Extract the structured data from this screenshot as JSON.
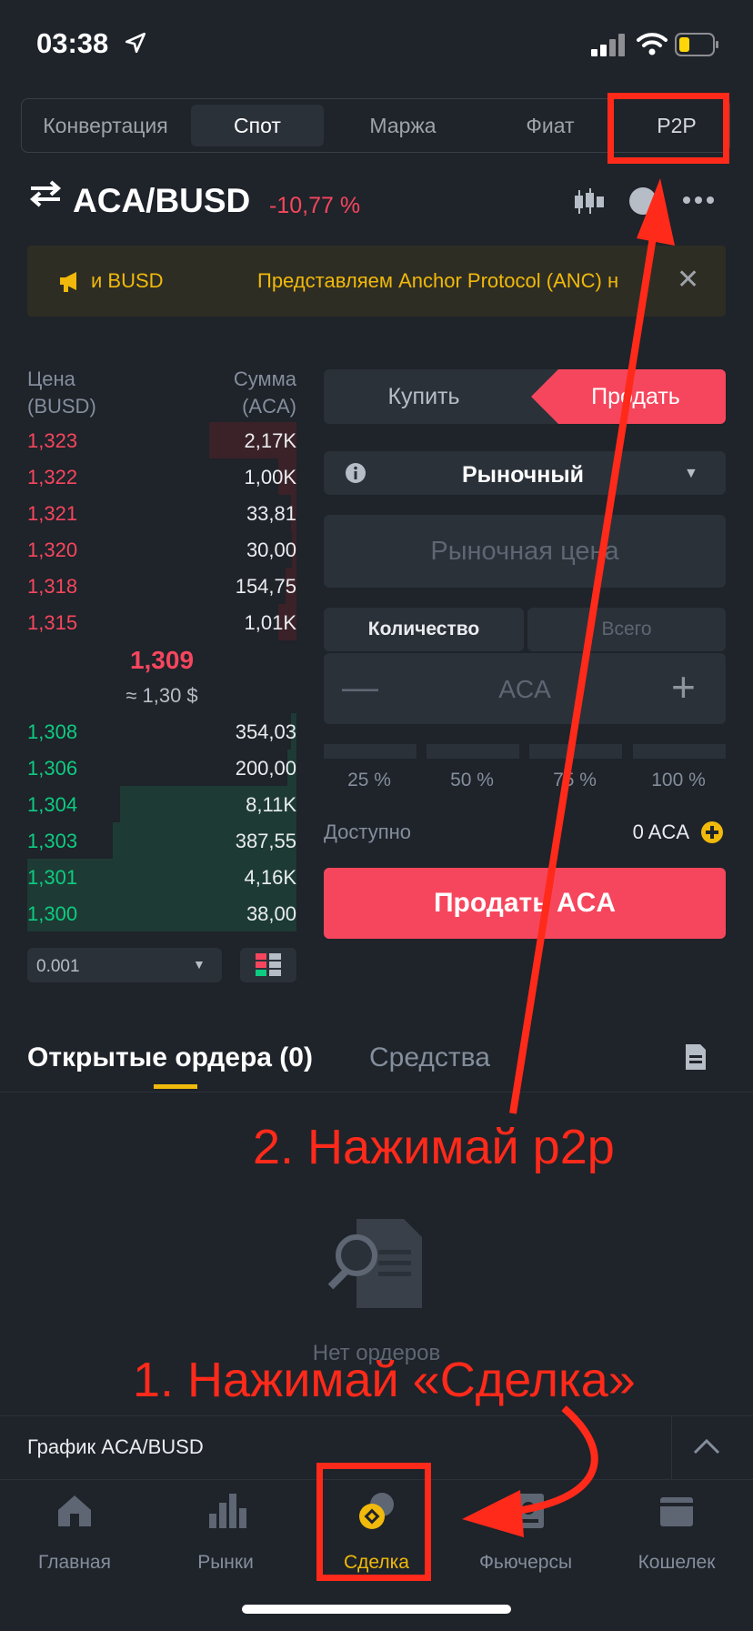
{
  "status": {
    "time": "03:38"
  },
  "tabs": [
    "Конвертация",
    "Спот",
    "Маржа",
    "Фиат",
    "P2P"
  ],
  "pair": {
    "name": "ACA/BUSD",
    "change": "-10,77 %"
  },
  "banner": {
    "text1": "и BUSD",
    "text2": "Представляем Anchor Protocol (ANC) н"
  },
  "orderbook": {
    "head_price": "Цена\n(BUSD)",
    "head_price_1": "Цена",
    "head_price_2": "(BUSD)",
    "head_amount_1": "Сумма",
    "head_amount_2": "(ACA)",
    "asks": [
      {
        "price": "1,323",
        "amount": "2,17K"
      },
      {
        "price": "1,322",
        "amount": "1,00K"
      },
      {
        "price": "1,321",
        "amount": "33,81"
      },
      {
        "price": "1,320",
        "amount": "30,00"
      },
      {
        "price": "1,318",
        "amount": "154,75"
      },
      {
        "price": "1,315",
        "amount": "1,01K"
      }
    ],
    "mid_price": "1,309",
    "mid_usd": "≈ 1,30 $",
    "bids": [
      {
        "price": "1,308",
        "amount": "354,03"
      },
      {
        "price": "1,306",
        "amount": "200,00"
      },
      {
        "price": "1,304",
        "amount": "8,11K"
      },
      {
        "price": "1,303",
        "amount": "387,55"
      },
      {
        "price": "1,301",
        "amount": "4,16K"
      },
      {
        "price": "1,300",
        "amount": "38,00"
      }
    ],
    "precision": "0.001"
  },
  "form": {
    "buy": "Купить",
    "sell": "Продать",
    "order_type": "Рыночный",
    "market_price": "Рыночная цена",
    "qty_tab": "Количество",
    "total_tab": "Всего",
    "qty_unit": "ACA",
    "pcts": [
      "25 %",
      "50 %",
      "75 %",
      "100 %"
    ],
    "available_label": "Доступно",
    "available_value": "0 ACA",
    "submit": "Продать ACA"
  },
  "orders": {
    "tab_open": "Открытые ордера (0)",
    "tab_funds": "Средства",
    "empty": "Нет ордеров"
  },
  "chart_bar": {
    "label": "График ACA/BUSD"
  },
  "nav": [
    "Главная",
    "Рынки",
    "Сделка",
    "Фьючерсы",
    "Кошелек"
  ],
  "annotations": {
    "step2": "2. Нажимай p2p",
    "step1": "1. Нажимай «Сделка»"
  }
}
